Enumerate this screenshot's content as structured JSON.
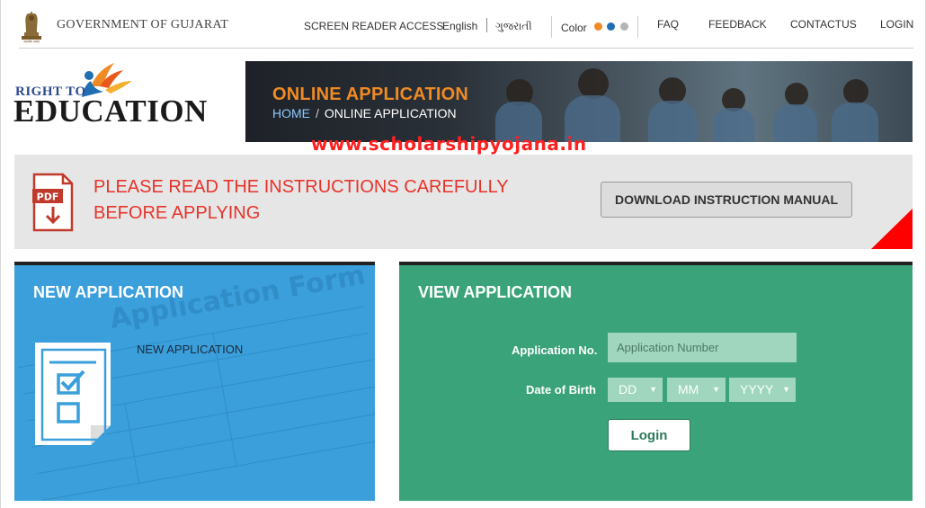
{
  "header": {
    "gov_name": "GOVERNMENT OF GUJARAT",
    "screen_reader": "SCREEN READER ACCESS",
    "lang_english": "English",
    "lang_gujarati": "ગુજરાતી",
    "color_label": "Color",
    "color_options": [
      "#f08a24",
      "#1f6fb2",
      "#b5b5b5"
    ],
    "nav": [
      "FAQ",
      "FEEDBACK",
      "CONTACTUS",
      "LOGIN"
    ]
  },
  "logo": {
    "line1": "RIGHT TO",
    "line2": "EDUCATION"
  },
  "banner": {
    "title": "ONLINE APPLICATION",
    "crumb_home": "HOME",
    "crumb_sep": "/",
    "crumb_current": "ONLINE APPLICATION"
  },
  "watermark": "www.scholarshipyojana.in",
  "instructions": {
    "line1": "PLEASE READ THE INSTRUCTIONS CAREFULLY",
    "line2": "BEFORE APPLYING",
    "download_label": "DOWNLOAD INSTRUCTION MANUAL",
    "pdf_label": "PDF"
  },
  "new_application": {
    "title": "NEW APPLICATION",
    "link": "NEW APPLICATION",
    "bg_heading": "Application Form"
  },
  "view_application": {
    "title": "VIEW APPLICATION",
    "app_no_label": "Application No.",
    "app_no_placeholder": "Application Number",
    "dob_label": "Date of Birth",
    "day": "DD",
    "month": "MM",
    "year": "YYYY",
    "login_label": "Login"
  },
  "colors": {
    "accent_orange": "#f08a24",
    "alert_red": "#e8332a",
    "new_panel_blue": "#3a9fdb",
    "view_panel_green": "#3aa37a"
  }
}
